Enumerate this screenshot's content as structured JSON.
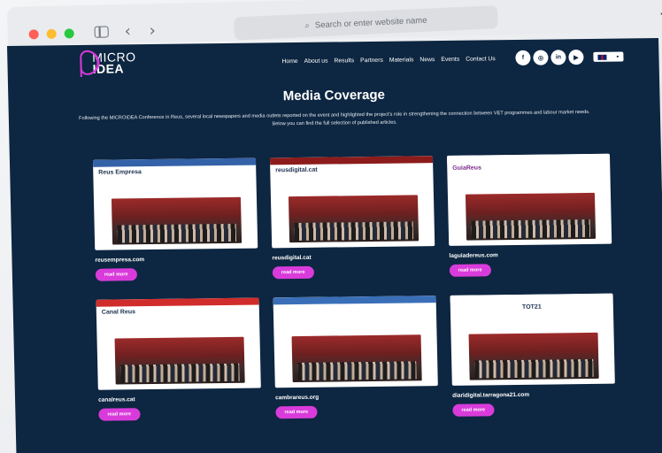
{
  "browser": {
    "url_placeholder": "Search or enter website name",
    "new_tab": "+"
  },
  "site": {
    "logo_line1": "MICRO",
    "logo_line2": "IDEA",
    "menu": [
      "Home",
      "About us",
      "Results",
      "Partners",
      "Materials",
      "News",
      "Events",
      "Contact Us"
    ],
    "socials": [
      "f",
      "◎",
      "in",
      "▶"
    ],
    "title": "Media Coverage",
    "intro_line1": "Following the MICROIDEA Conference in Reus, several local newspapers and media outlets reported on the event and highlighted the project's role in strengthening the connection between VET programmes and labour market needs.",
    "intro_line2": "Below you can find the full selection of published articles.",
    "articles": [
      {
        "site": "reusempresa.com",
        "head": "Reus Empresa",
        "bar_color": "#3462a8",
        "button": "read more"
      },
      {
        "site": "reusdigital.cat",
        "head": "reusdigital.cat",
        "bar_color": "#8c1c1c",
        "button": "read more"
      },
      {
        "site": "laguiadereus.com",
        "head": "GuiaReus",
        "bar_color": "#ffffff",
        "button": "read more"
      },
      {
        "site": "canalreus.cat",
        "head": "Canal Reus",
        "bar_color": "#d12c2c",
        "button": "read more"
      },
      {
        "site": "cambrareus.org",
        "head": "",
        "bar_color": "#3a6fb8",
        "button": "read more"
      },
      {
        "site": "diaridigital.tarragona21.com",
        "head": "TOT21",
        "bar_color": "#ffffff",
        "button": "read more"
      }
    ]
  },
  "colors": {
    "background": "#0d2641",
    "accent": "#d93bdb"
  }
}
